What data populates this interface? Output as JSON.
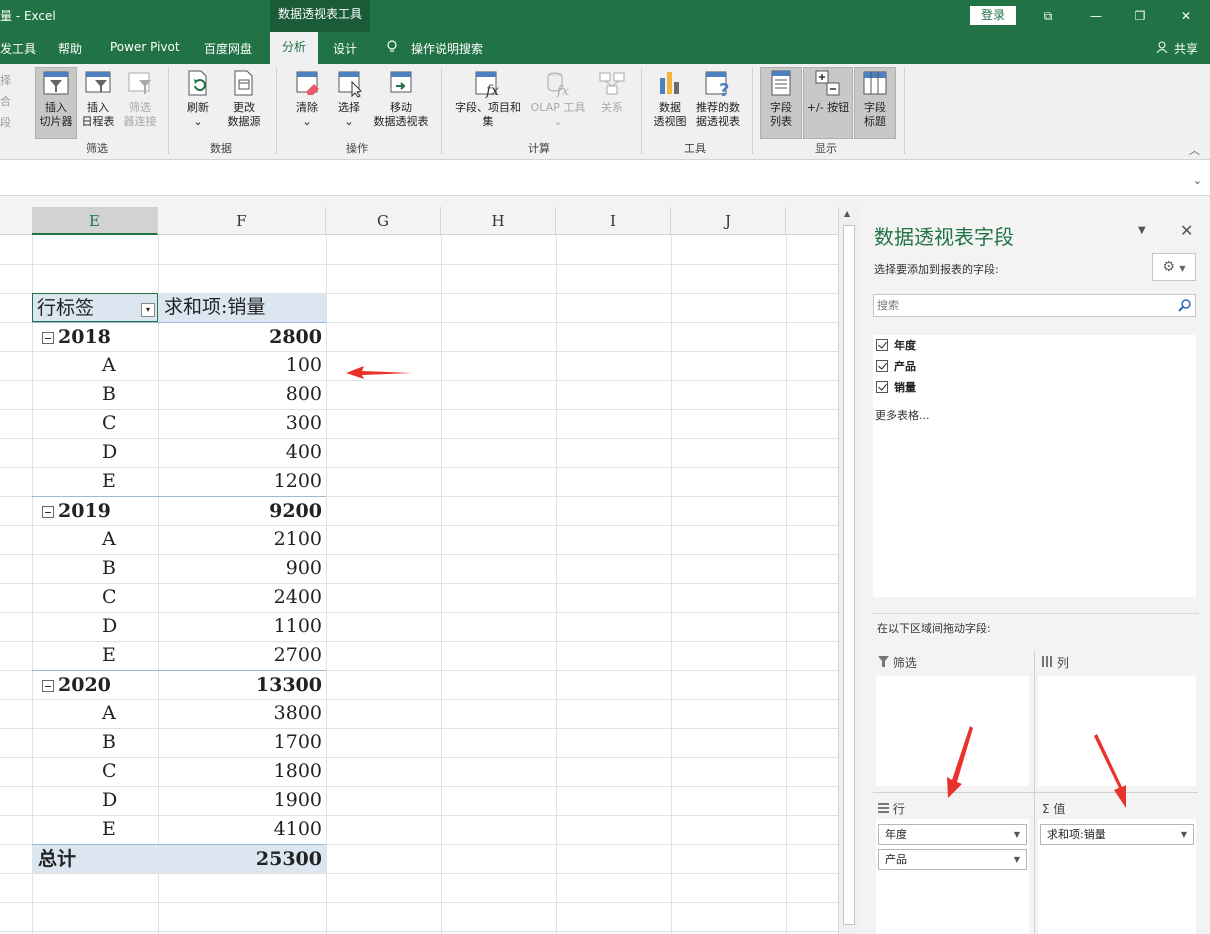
{
  "titlebar": {
    "title": "量 - Excel",
    "context_tab": "数据透视表工具",
    "login": "登录",
    "win_btns": [
      "⧉",
      "—",
      "❐",
      "✕"
    ]
  },
  "tabs": {
    "items": [
      "发工具",
      "帮助",
      "Power Pivot",
      "百度网盘",
      "分析",
      "设计",
      "操作说明搜索"
    ],
    "share": "共享"
  },
  "ribbon": {
    "left_cut": [
      "择",
      "合",
      "段"
    ],
    "buttons": {
      "insert_slicer": "插入\n切片器",
      "insert_timeline": "插入\n日程表",
      "filter_conn": "筛选\n器连接",
      "refresh": "刷新",
      "change_source": "更改\n数据源",
      "clear": "清除",
      "select": "选择",
      "move": "移动\n数据透视表",
      "fields_items": "字段、项目和\n集",
      "olap": "OLAP 工具",
      "relations": "关系",
      "pivot_chart": "数据\n透视图",
      "recommended": "推荐的数\n据透视表",
      "field_list": "字段\n列表",
      "buttons": "+/- 按钮",
      "field_headers": "字段\n标题"
    },
    "groups": {
      "filter": "筛选",
      "data": "数据",
      "ops": "操作",
      "calc": "计算",
      "tools": "工具",
      "show": "显示"
    }
  },
  "columns": [
    "E",
    "F",
    "G",
    "H",
    "I",
    "J"
  ],
  "pivot": {
    "row_label_header": "行标签",
    "value_header": "求和项:销量",
    "groups": [
      {
        "year": "2018",
        "total": "2800",
        "items": [
          [
            "A",
            "100"
          ],
          [
            "B",
            "800"
          ],
          [
            "C",
            "300"
          ],
          [
            "D",
            "400"
          ],
          [
            "E",
            "1200"
          ]
        ]
      },
      {
        "year": "2019",
        "total": "9200",
        "items": [
          [
            "A",
            "2100"
          ],
          [
            "B",
            "900"
          ],
          [
            "C",
            "2400"
          ],
          [
            "D",
            "1100"
          ],
          [
            "E",
            "2700"
          ]
        ]
      },
      {
        "year": "2020",
        "total": "13300",
        "items": [
          [
            "A",
            "3800"
          ],
          [
            "B",
            "1700"
          ],
          [
            "C",
            "1800"
          ],
          [
            "D",
            "1900"
          ],
          [
            "E",
            "4100"
          ]
        ]
      }
    ],
    "grand_total_label": "总计",
    "grand_total": "25300"
  },
  "pane": {
    "title": "数据透视表字段",
    "subtitle": "选择要添加到报表的字段:",
    "search_placeholder": "搜索",
    "fields": [
      "年度",
      "产品",
      "销量"
    ],
    "more_tables": "更多表格...",
    "drag_hint": "在以下区域间拖动字段:",
    "areas": {
      "filter": "筛选",
      "columns": "列",
      "rows": "行",
      "values": "值"
    },
    "row_items": [
      "年度",
      "产品"
    ],
    "value_items": [
      "求和项:销量"
    ]
  },
  "colors": {
    "excel_green": "#217346",
    "pivot_header_bg": "#dce6f1",
    "annotation_red": "#e8322b"
  }
}
